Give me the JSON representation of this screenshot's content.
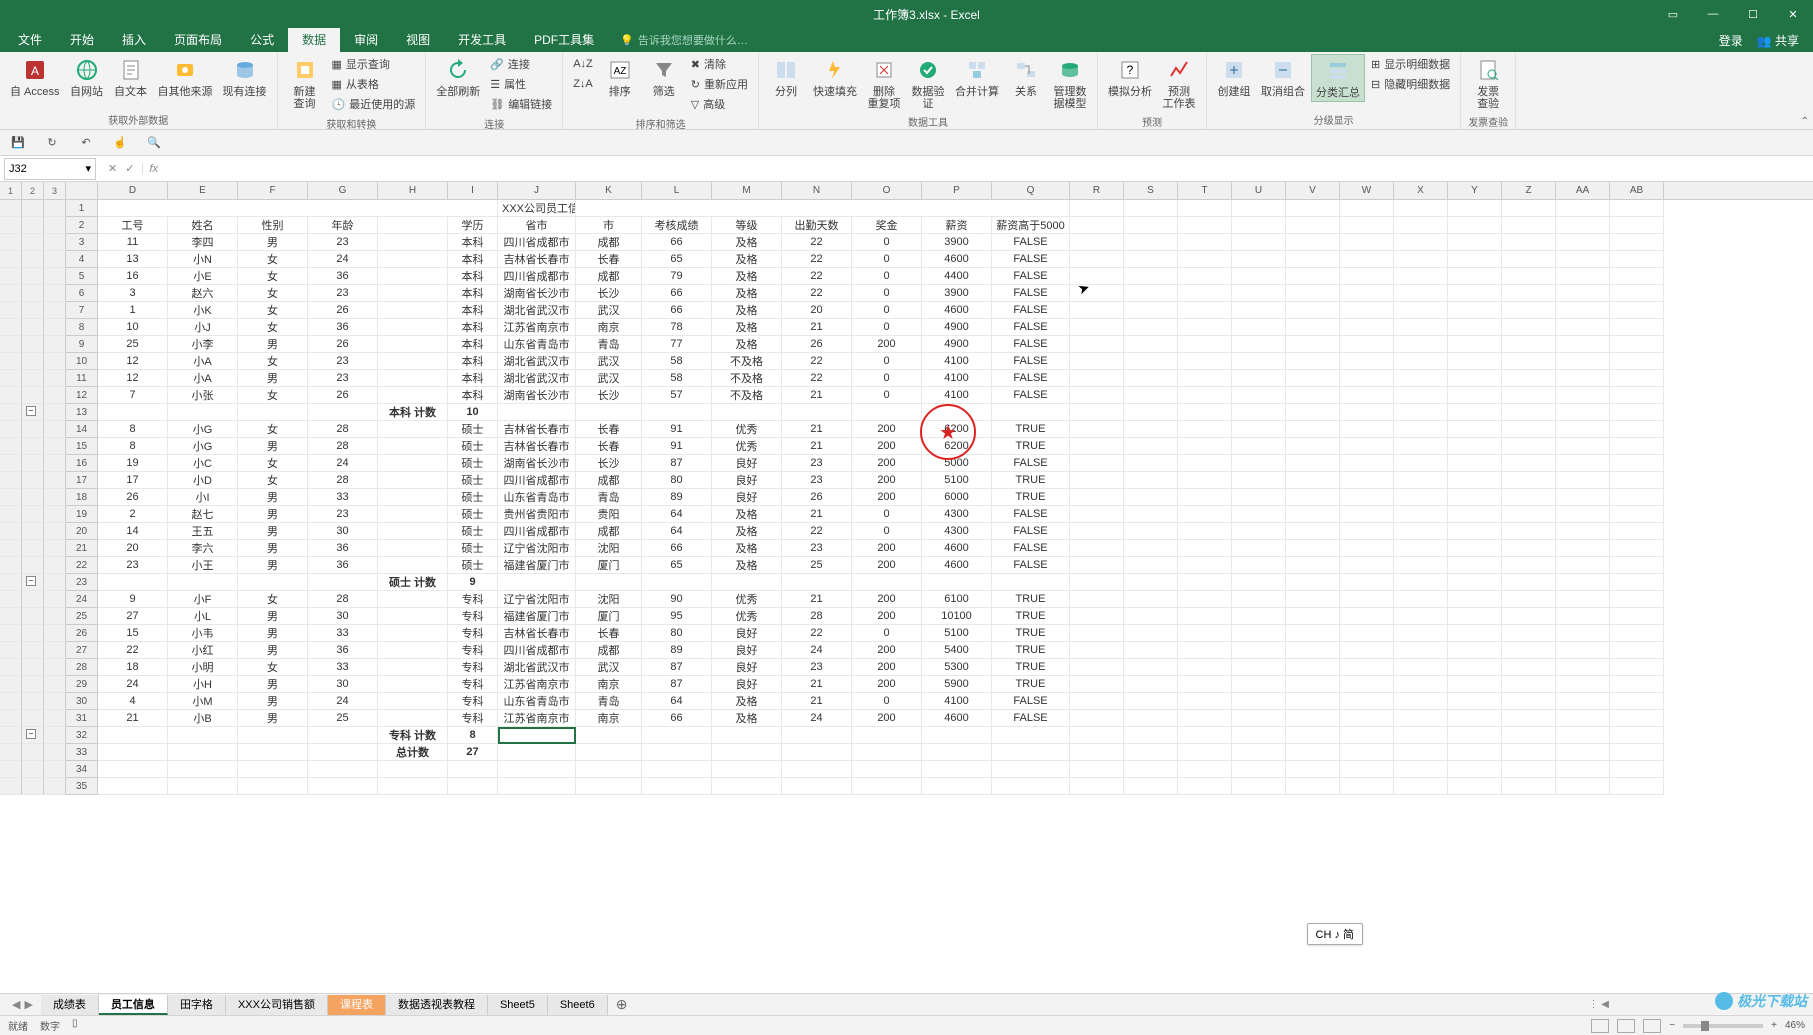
{
  "window": {
    "title": "工作簿3.xlsx - Excel"
  },
  "tabs": {
    "file": "文件",
    "home": "开始",
    "insert": "插入",
    "layout": "页面布局",
    "formulas": "公式",
    "data": "数据",
    "review": "审阅",
    "view": "视图",
    "dev": "开发工具",
    "pdf": "PDF工具集",
    "tellme": "告诉我您想要做什么…"
  },
  "account": {
    "login": "登录",
    "share": "共享"
  },
  "ribbon": {
    "ext": {
      "access": "自 Access",
      "web": "自网站",
      "text": "自文本",
      "other": "自其他来源",
      "existing": "现有连接",
      "group": "获取外部数据"
    },
    "get": {
      "newquery": "新建\n查询",
      "showq": "显示查询",
      "fromtable": "从表格",
      "recent": "最近使用的源",
      "group": "获取和转换"
    },
    "conn": {
      "refresh": "全部刷新",
      "conns": "连接",
      "props": "属性",
      "editlinks": "编辑链接",
      "group": "连接"
    },
    "sort": {
      "az": "⬇",
      "za": "⬆",
      "sort": "排序",
      "filter": "筛选",
      "clear": "清除",
      "reapply": "重新应用",
      "adv": "高级",
      "group": "排序和筛选"
    },
    "tools": {
      "t2c": "分列",
      "flash": "快速填充",
      "dup": "删除\n重复项",
      "valid": "数据验\n证",
      "consol": "合并计算",
      "rel": "关系",
      "model": "管理数\n据模型",
      "group": "数据工具"
    },
    "forecast": {
      "whatif": "模拟分析",
      "sheet": "预测\n工作表",
      "group": "预测"
    },
    "outline": {
      "group_btn": "创建组",
      "ungroup": "取消组合",
      "subtotal": "分类汇总",
      "show": "显示明细数据",
      "hide": "隐藏明细数据",
      "group": "分级显示"
    },
    "invoice": {
      "btn": "发票\n查验",
      "group": "发票查验"
    }
  },
  "nameBox": "J32",
  "columns": [
    "D",
    "E",
    "F",
    "G",
    "H",
    "I",
    "J",
    "K",
    "L",
    "M",
    "N",
    "O",
    "P",
    "Q",
    "R",
    "S",
    "T",
    "U",
    "V",
    "W",
    "X",
    "Y",
    "Z",
    "AA",
    "AB"
  ],
  "tailCols": [
    "R",
    "S",
    "T",
    "U",
    "V",
    "W",
    "X",
    "Y",
    "Z",
    "AA",
    "AB"
  ],
  "headers": {
    "title": "XXX公司员工信息",
    "id": "工号",
    "name": "姓名",
    "gender": "性别",
    "age": "年龄",
    "edu": "学历",
    "prov": "省市",
    "city": "市",
    "score": "考核成绩",
    "level": "等级",
    "days": "出勤天数",
    "bonus": "奖金",
    "salary": "薪资",
    "gt5000": "薪资高于5000"
  },
  "subtotals": {
    "bk": "本科 计数",
    "bk_v": "10",
    "ss": "硕士 计数",
    "ss_v": "9",
    "zk": "专科 计数",
    "zk_v": "8",
    "total": "总计数",
    "total_v": "27"
  },
  "rows": [
    {
      "rn": 3,
      "id": "11",
      "name": "李四",
      "gender": "男",
      "age": "23",
      "edu": "本科",
      "prov": "四川省成都市",
      "city": "成都",
      "score": "66",
      "level": "及格",
      "days": "22",
      "bonus": "0",
      "salary": "3900",
      "gt": "FALSE"
    },
    {
      "rn": 4,
      "id": "13",
      "name": "小N",
      "gender": "女",
      "age": "24",
      "edu": "本科",
      "prov": "吉林省长春市",
      "city": "长春",
      "score": "65",
      "level": "及格",
      "days": "22",
      "bonus": "0",
      "salary": "4600",
      "gt": "FALSE"
    },
    {
      "rn": 5,
      "id": "16",
      "name": "小E",
      "gender": "女",
      "age": "36",
      "edu": "本科",
      "prov": "四川省成都市",
      "city": "成都",
      "score": "79",
      "level": "及格",
      "days": "22",
      "bonus": "0",
      "salary": "4400",
      "gt": "FALSE"
    },
    {
      "rn": 6,
      "id": "3",
      "name": "赵六",
      "gender": "女",
      "age": "23",
      "edu": "本科",
      "prov": "湖南省长沙市",
      "city": "长沙",
      "score": "66",
      "level": "及格",
      "days": "22",
      "bonus": "0",
      "salary": "3900",
      "gt": "FALSE"
    },
    {
      "rn": 7,
      "id": "1",
      "name": "小K",
      "gender": "女",
      "age": "26",
      "edu": "本科",
      "prov": "湖北省武汉市",
      "city": "武汉",
      "score": "66",
      "level": "及格",
      "days": "20",
      "bonus": "0",
      "salary": "4600",
      "gt": "FALSE"
    },
    {
      "rn": 8,
      "id": "10",
      "name": "小J",
      "gender": "女",
      "age": "36",
      "edu": "本科",
      "prov": "江苏省南京市",
      "city": "南京",
      "score": "78",
      "level": "及格",
      "days": "21",
      "bonus": "0",
      "salary": "4900",
      "gt": "FALSE"
    },
    {
      "rn": 9,
      "id": "25",
      "name": "小李",
      "gender": "男",
      "age": "26",
      "edu": "本科",
      "prov": "山东省青岛市",
      "city": "青岛",
      "score": "77",
      "level": "及格",
      "days": "26",
      "bonus": "200",
      "salary": "4900",
      "gt": "FALSE"
    },
    {
      "rn": 10,
      "id": "12",
      "name": "小A",
      "gender": "女",
      "age": "23",
      "edu": "本科",
      "prov": "湖北省武汉市",
      "city": "武汉",
      "score": "58",
      "level": "不及格",
      "days": "22",
      "bonus": "0",
      "salary": "4100",
      "gt": "FALSE"
    },
    {
      "rn": 11,
      "id": "12",
      "name": "小A",
      "gender": "男",
      "age": "23",
      "edu": "本科",
      "prov": "湖北省武汉市",
      "city": "武汉",
      "score": "58",
      "level": "不及格",
      "days": "22",
      "bonus": "0",
      "salary": "4100",
      "gt": "FALSE"
    },
    {
      "rn": 12,
      "id": "7",
      "name": "小张",
      "gender": "女",
      "age": "26",
      "edu": "本科",
      "prov": "湖南省长沙市",
      "city": "长沙",
      "score": "57",
      "level": "不及格",
      "days": "21",
      "bonus": "0",
      "salary": "4100",
      "gt": "FALSE"
    },
    {
      "rn": 14,
      "id": "8",
      "name": "小G",
      "gender": "女",
      "age": "28",
      "edu": "硕士",
      "prov": "吉林省长春市",
      "city": "长春",
      "score": "91",
      "level": "优秀",
      "days": "21",
      "bonus": "200",
      "salary": "6200",
      "gt": "TRUE"
    },
    {
      "rn": 15,
      "id": "8",
      "name": "小G",
      "gender": "男",
      "age": "28",
      "edu": "硕士",
      "prov": "吉林省长春市",
      "city": "长春",
      "score": "91",
      "level": "优秀",
      "days": "21",
      "bonus": "200",
      "salary": "6200",
      "gt": "TRUE"
    },
    {
      "rn": 16,
      "id": "19",
      "name": "小C",
      "gender": "女",
      "age": "24",
      "edu": "硕士",
      "prov": "湖南省长沙市",
      "city": "长沙",
      "score": "87",
      "level": "良好",
      "days": "23",
      "bonus": "200",
      "salary": "5000",
      "gt": "FALSE"
    },
    {
      "rn": 17,
      "id": "17",
      "name": "小D",
      "gender": "女",
      "age": "28",
      "edu": "硕士",
      "prov": "四川省成都市",
      "city": "成都",
      "score": "80",
      "level": "良好",
      "days": "23",
      "bonus": "200",
      "salary": "5100",
      "gt": "TRUE"
    },
    {
      "rn": 18,
      "id": "26",
      "name": "小I",
      "gender": "男",
      "age": "33",
      "edu": "硕士",
      "prov": "山东省青岛市",
      "city": "青岛",
      "score": "89",
      "level": "良好",
      "days": "26",
      "bonus": "200",
      "salary": "6000",
      "gt": "TRUE"
    },
    {
      "rn": 19,
      "id": "2",
      "name": "赵七",
      "gender": "男",
      "age": "23",
      "edu": "硕士",
      "prov": "贵州省贵阳市",
      "city": "贵阳",
      "score": "64",
      "level": "及格",
      "days": "21",
      "bonus": "0",
      "salary": "4300",
      "gt": "FALSE"
    },
    {
      "rn": 20,
      "id": "14",
      "name": "王五",
      "gender": "男",
      "age": "30",
      "edu": "硕士",
      "prov": "四川省成都市",
      "city": "成都",
      "score": "64",
      "level": "及格",
      "days": "22",
      "bonus": "0",
      "salary": "4300",
      "gt": "FALSE"
    },
    {
      "rn": 21,
      "id": "20",
      "name": "李六",
      "gender": "男",
      "age": "36",
      "edu": "硕士",
      "prov": "辽宁省沈阳市",
      "city": "沈阳",
      "score": "66",
      "level": "及格",
      "days": "23",
      "bonus": "200",
      "salary": "4600",
      "gt": "FALSE"
    },
    {
      "rn": 22,
      "id": "23",
      "name": "小王",
      "gender": "男",
      "age": "36",
      "edu": "硕士",
      "prov": "福建省厦门市",
      "city": "厦门",
      "score": "65",
      "level": "及格",
      "days": "25",
      "bonus": "200",
      "salary": "4600",
      "gt": "FALSE"
    },
    {
      "rn": 24,
      "id": "9",
      "name": "小F",
      "gender": "女",
      "age": "28",
      "edu": "专科",
      "prov": "辽宁省沈阳市",
      "city": "沈阳",
      "score": "90",
      "level": "优秀",
      "days": "21",
      "bonus": "200",
      "salary": "6100",
      "gt": "TRUE"
    },
    {
      "rn": 25,
      "id": "27",
      "name": "小L",
      "gender": "男",
      "age": "30",
      "edu": "专科",
      "prov": "福建省厦门市",
      "city": "厦门",
      "score": "95",
      "level": "优秀",
      "days": "28",
      "bonus": "200",
      "salary": "10100",
      "gt": "TRUE"
    },
    {
      "rn": 26,
      "id": "15",
      "name": "小韦",
      "gender": "男",
      "age": "33",
      "edu": "专科",
      "prov": "吉林省长春市",
      "city": "长春",
      "score": "80",
      "level": "良好",
      "days": "22",
      "bonus": "0",
      "salary": "5100",
      "gt": "TRUE"
    },
    {
      "rn": 27,
      "id": "22",
      "name": "小红",
      "gender": "男",
      "age": "36",
      "edu": "专科",
      "prov": "四川省成都市",
      "city": "成都",
      "score": "89",
      "level": "良好",
      "days": "24",
      "bonus": "200",
      "salary": "5400",
      "gt": "TRUE"
    },
    {
      "rn": 28,
      "id": "18",
      "name": "小明",
      "gender": "女",
      "age": "33",
      "edu": "专科",
      "prov": "湖北省武汉市",
      "city": "武汉",
      "score": "87",
      "level": "良好",
      "days": "23",
      "bonus": "200",
      "salary": "5300",
      "gt": "TRUE"
    },
    {
      "rn": 29,
      "id": "24",
      "name": "小H",
      "gender": "男",
      "age": "30",
      "edu": "专科",
      "prov": "江苏省南京市",
      "city": "南京",
      "score": "87",
      "level": "良好",
      "days": "21",
      "bonus": "200",
      "salary": "5900",
      "gt": "TRUE"
    },
    {
      "rn": 30,
      "id": "4",
      "name": "小M",
      "gender": "男",
      "age": "24",
      "edu": "专科",
      "prov": "山东省青岛市",
      "city": "青岛",
      "score": "64",
      "level": "及格",
      "days": "21",
      "bonus": "0",
      "salary": "4100",
      "gt": "FALSE"
    },
    {
      "rn": 31,
      "id": "21",
      "name": "小B",
      "gender": "男",
      "age": "25",
      "edu": "专科",
      "prov": "江苏省南京市",
      "city": "南京",
      "score": "66",
      "level": "及格",
      "days": "24",
      "bonus": "200",
      "salary": "4600",
      "gt": "FALSE"
    }
  ],
  "sheets": {
    "s1": "成绩表",
    "s2": "员工信息",
    "s3": "田字格",
    "s4": "XXX公司销售额",
    "s5": "课程表",
    "s6": "数据透视表教程",
    "s7": "Sheet5",
    "s8": "Sheet6"
  },
  "status": {
    "ready": "就绪",
    "mode": "数字",
    "zoom": "46%"
  },
  "ime": "CH ♪ 简",
  "watermark": "极光下载站"
}
